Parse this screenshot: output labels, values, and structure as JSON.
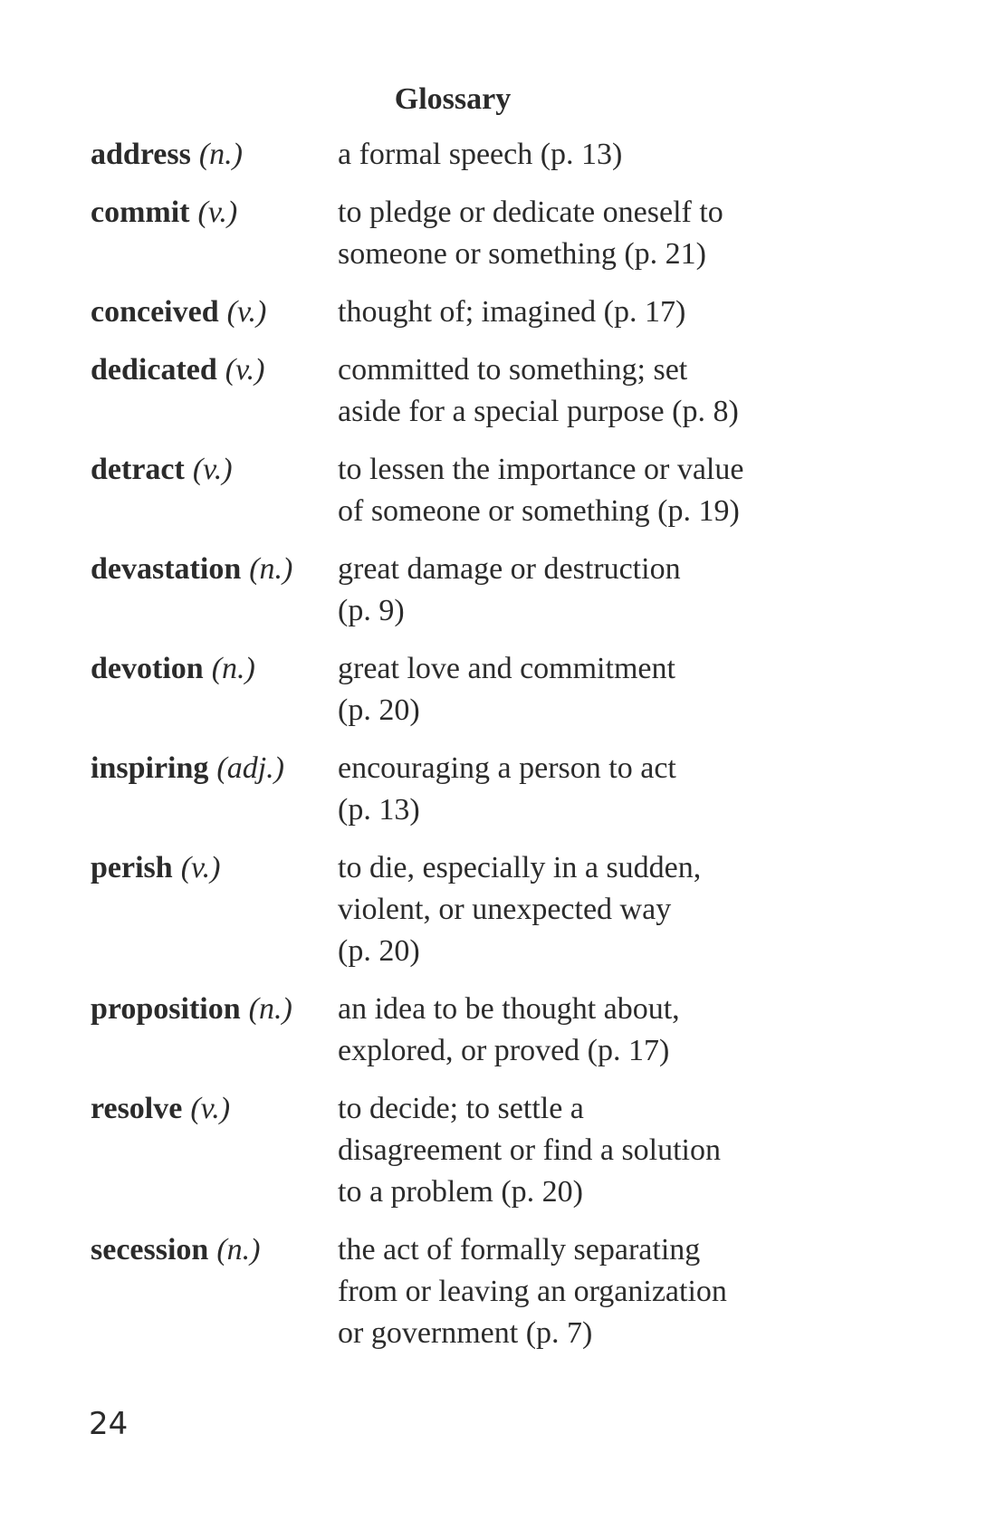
{
  "title": "Glossary",
  "entries": [
    {
      "term": "address",
      "pos": "(n.)",
      "lines": [
        "a formal speech (p. 13)"
      ]
    },
    {
      "term": "commit",
      "pos": "(v.)",
      "lines": [
        "to pledge or dedicate oneself to",
        "someone or something (p. 21)"
      ]
    },
    {
      "term": "conceived",
      "pos": "(v.)",
      "lines": [
        "thought of; imagined (p. 17)"
      ]
    },
    {
      "term": "dedicated",
      "pos": "(v.)",
      "lines": [
        "committed to something; set",
        "aside for a special purpose (p. 8)"
      ]
    },
    {
      "term": "detract",
      "pos": "(v.)",
      "lines": [
        "to lessen the importance or value",
        "of someone or something (p. 19)"
      ]
    },
    {
      "term": "devastation",
      "pos": "(n.)",
      "lines": [
        "great damage or destruction",
        "(p. 9)"
      ]
    },
    {
      "term": "devotion",
      "pos": "(n.)",
      "lines": [
        "great love and commitment",
        "(p. 20)"
      ]
    },
    {
      "term": "inspiring",
      "pos": "(adj.)",
      "lines": [
        "encouraging a person to act",
        "(p. 13)"
      ]
    },
    {
      "term": "perish",
      "pos": "(v.)",
      "lines": [
        "to die, especially in a sudden,",
        "violent, or unexpected way",
        "(p. 20)"
      ]
    },
    {
      "term": "proposition",
      "pos": "(n.)",
      "lines": [
        "an idea to be thought about,",
        "explored, or proved (p. 17)"
      ]
    },
    {
      "term": "resolve",
      "pos": "(v.)",
      "lines": [
        "to decide; to settle a",
        "disagreement or find a solution",
        "to a problem (p. 20)"
      ]
    },
    {
      "term": "secession",
      "pos": "(n.)",
      "lines": [
        "the act of formally separating",
        "from or leaving an organization",
        "or government (p. 7)"
      ]
    }
  ],
  "page_number": "24"
}
